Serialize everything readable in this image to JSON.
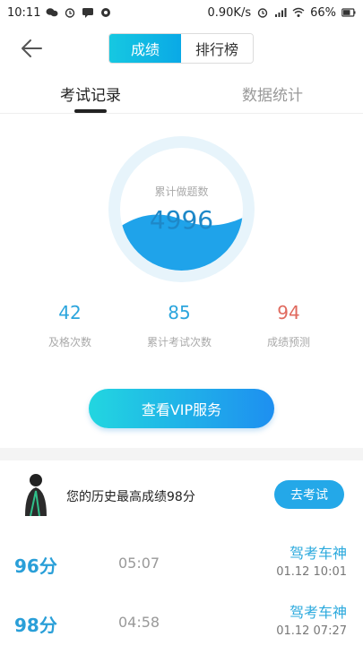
{
  "status_bar": {
    "time": "10:11",
    "speed": "0.90K/s",
    "battery": "66%",
    "left_icons": [
      "wechat-icon",
      "alarm-icon",
      "message-icon",
      "notification-icon"
    ],
    "right_icons": [
      "alarm-icon",
      "signal-icon",
      "wifi-icon",
      "battery-icon"
    ]
  },
  "header": {
    "tabs": [
      "成绩",
      "排行榜"
    ],
    "active_tab": "成绩"
  },
  "subtabs": {
    "items": [
      "考试记录",
      "数据统计"
    ],
    "active": "考试记录"
  },
  "stats": {
    "ring_label": "累计做题数",
    "ring_value": "4996",
    "metrics": [
      {
        "value": "42",
        "label": "及格次数",
        "color": "#2ba5dd"
      },
      {
        "value": "85",
        "label": "累计考试次数",
        "color": "#2ba5dd"
      },
      {
        "value": "94",
        "label": "成绩预测",
        "color": "#e06a5e"
      }
    ],
    "vip_button": "查看VIP服务"
  },
  "best": {
    "text": "您的历史最高成绩98分",
    "button": "去考试"
  },
  "records": [
    {
      "score": "96分",
      "duration": "05:07",
      "title": "驾考车神",
      "date": "01.12  10:01"
    },
    {
      "score": "98分",
      "duration": "04:58",
      "title": "驾考车神",
      "date": "01.12  07:27"
    }
  ],
  "colors": {
    "accent": "#16c8e1",
    "blue": "#2ba5dd",
    "red": "#e06a5e"
  }
}
